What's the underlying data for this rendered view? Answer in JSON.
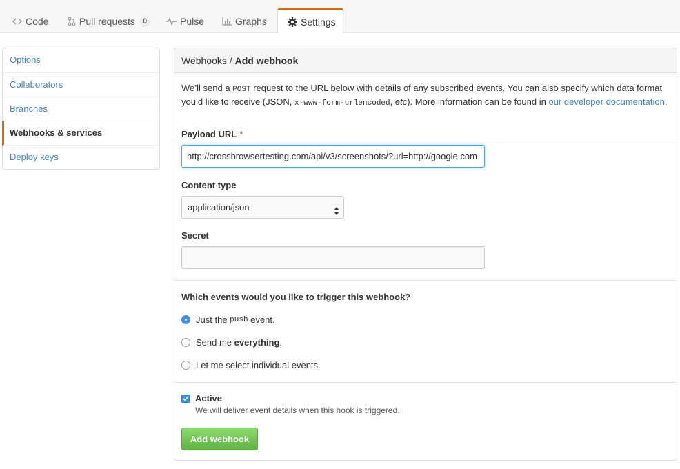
{
  "tabs": [
    {
      "label": "Code",
      "icon": "code-icon"
    },
    {
      "label": "Pull requests",
      "icon": "pull-request-icon",
      "count": "0"
    },
    {
      "label": "Pulse",
      "icon": "pulse-icon"
    },
    {
      "label": "Graphs",
      "icon": "graph-icon"
    },
    {
      "label": "Settings",
      "icon": "gear-icon",
      "selected": true
    }
  ],
  "sidebar": {
    "items": [
      {
        "label": "Options"
      },
      {
        "label": "Collaborators"
      },
      {
        "label": "Branches"
      },
      {
        "label": "Webhooks & services",
        "active": true
      },
      {
        "label": "Deploy keys"
      }
    ]
  },
  "header": {
    "breadcrumb_parent": "Webhooks",
    "separator": " / ",
    "title": "Add webhook"
  },
  "intro": {
    "part1": "We’ll send a ",
    "post": "POST",
    "part2": " request to the URL below with details of any subscribed events. You can also specify which data format you’d like to receive (JSON, ",
    "urlencoded": "x-www-form-urlencoded",
    "comma": ", ",
    "etc": "etc",
    "part3": "). More information can be found in ",
    "link": "our developer documentation",
    "end": "."
  },
  "form": {
    "payload_label": "Payload URL",
    "required_mark": "*",
    "payload_value": "http://crossbrowsertesting.com/api/v3/screenshots/?url=http://google.com",
    "content_type_label": "Content type",
    "content_type_value": "application/json",
    "secret_label": "Secret",
    "secret_value": ""
  },
  "events": {
    "question": "Which events would you like to trigger this webhook?",
    "options": [
      {
        "pre": "Just the ",
        "code": "push",
        "post": " event.",
        "selected": true
      },
      {
        "pre": "Send me ",
        "bold": "everything",
        "post": "."
      },
      {
        "pre": "Let me select individual events.",
        "selected": false
      }
    ]
  },
  "active": {
    "label": "Active",
    "checked": true,
    "note": "We will deliver event details when this hook is triggered."
  },
  "submit_label": "Add webhook",
  "colors": {
    "accent_orange": "#d26911",
    "link_blue": "#4183c4",
    "button_green": "#60b044",
    "radio_blue": "#3b8ff3"
  }
}
